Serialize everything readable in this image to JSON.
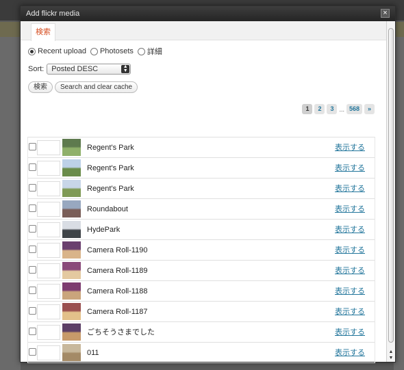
{
  "modal": {
    "title": "Add flickr media"
  },
  "tabs": [
    {
      "label": "検索"
    }
  ],
  "source_options": [
    {
      "label": "Recent upload",
      "checked": true
    },
    {
      "label": "Photosets",
      "checked": false
    },
    {
      "label": "詳細",
      "checked": false
    }
  ],
  "sort": {
    "label": "Sort:",
    "selected": "Posted DESC"
  },
  "buttons": {
    "search": "検索",
    "clear_cache": "Search and clear cache"
  },
  "pagination": {
    "current": "1",
    "pages": [
      "1",
      "2",
      "3"
    ],
    "ellipsis": "...",
    "last": "568",
    "next": "»"
  },
  "photos": [
    {
      "title": "Regent's Park",
      "link": "表示する",
      "thumb_colors": [
        "#5e7a4e",
        "#8fb06a"
      ]
    },
    {
      "title": "Regent's Park",
      "link": "表示する",
      "thumb_colors": [
        "#bdd1e8",
        "#6a8c4a"
      ]
    },
    {
      "title": "Regent's Park",
      "link": "表示する",
      "thumb_colors": [
        "#c8d6e8",
        "#7f9a55"
      ]
    },
    {
      "title": "Roundabout",
      "link": "表示する",
      "thumb_colors": [
        "#98a8c0",
        "#7a5e58"
      ]
    },
    {
      "title": "HydePark",
      "link": "表示する",
      "thumb_colors": [
        "#d9dde4",
        "#3f4448"
      ]
    },
    {
      "title": "Camera Roll-1190",
      "link": "表示する",
      "thumb_colors": [
        "#6a3f6e",
        "#d9b48a"
      ]
    },
    {
      "title": "Camera Roll-1189",
      "link": "表示する",
      "thumb_colors": [
        "#8a4a7a",
        "#e4c9a0"
      ]
    },
    {
      "title": "Camera Roll-1188",
      "link": "表示する",
      "thumb_colors": [
        "#7d3c70",
        "#caa57c"
      ]
    },
    {
      "title": "Camera Roll-1187",
      "link": "表示する",
      "thumb_colors": [
        "#9a5050",
        "#e3c08a"
      ]
    },
    {
      "title": "ごちそうさまでした",
      "link": "表示する",
      "thumb_colors": [
        "#5c3f66",
        "#c79a6a"
      ]
    },
    {
      "title": "011",
      "link": "表示する",
      "thumb_colors": [
        "#c8b89c",
        "#a48a66"
      ]
    }
  ],
  "colors": {
    "accent": "#d54e21",
    "link": "#21759b",
    "titlebar": "#2b2b2b"
  }
}
